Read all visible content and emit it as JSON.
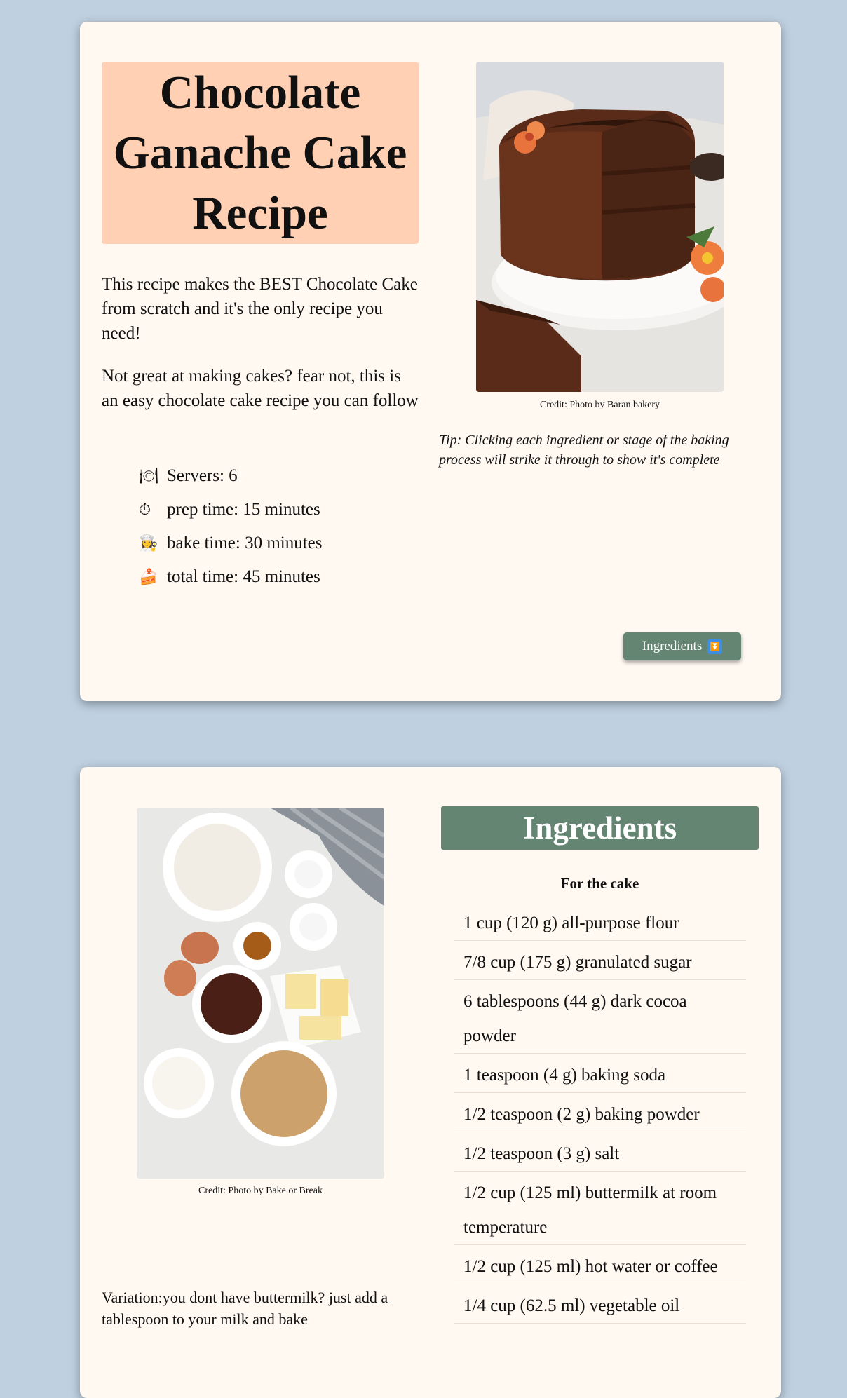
{
  "intro": {
    "title": "Chocolate Ganache Cake Recipe",
    "paragraph1": "This recipe makes the BEST Chocolate Cake from scratch and it's the only recipe you need!",
    "paragraph2": "Not great at making cakes? fear not, this is an easy chocolate cake recipe you can follow",
    "stats": [
      {
        "icon": "fork-and-knife-plate-icon",
        "glyph": "🍽",
        "text": "Servers: 6"
      },
      {
        "icon": "stopwatch-icon",
        "glyph": "⏱",
        "text": "prep time: 15 minutes"
      },
      {
        "icon": "cook-icon",
        "glyph": "👩‍🍳",
        "text": "bake time: 30 minutes"
      },
      {
        "icon": "cake-slice-icon",
        "glyph": "🍰",
        "text": "total time: 45 minutes"
      }
    ],
    "photo_credit": "Credit: Photo by Baran bakery",
    "tip": "Tip: Clicking each ingredient or stage of the baking process will strike it through to show it's complete",
    "button_label": "Ingredients",
    "button_icon": "double-down-arrow-icon"
  },
  "ingredients_section": {
    "photo_credit": "Credit: Photo by Bake or Break",
    "variation": "Variation:you dont have buttermilk? just add a tablespoon to your milk and bake",
    "heading": "Ingredients",
    "subheading": "For the cake",
    "items": [
      "1 cup (120 g) all-purpose flour",
      "7/8 cup (175 g) granulated sugar",
      "6 tablespoons (44 g) dark cocoa powder",
      "1 teaspoon (4 g) baking soda",
      "1/2 teaspoon (2 g) baking powder",
      "1/2 teaspoon (3 g) salt",
      "1/2 cup (125 ml) buttermilk at room temperature",
      "1/2 cup (125 ml) hot water or coffee",
      "1/4 cup (62.5 ml) vegetable oil"
    ]
  },
  "colors": {
    "page_background": "#bfd0e0",
    "card_background": "#fff9f2",
    "title_box": "#ffd0b3",
    "accent_green": "#658573",
    "button_icon_blue": "#3d8ee6"
  }
}
